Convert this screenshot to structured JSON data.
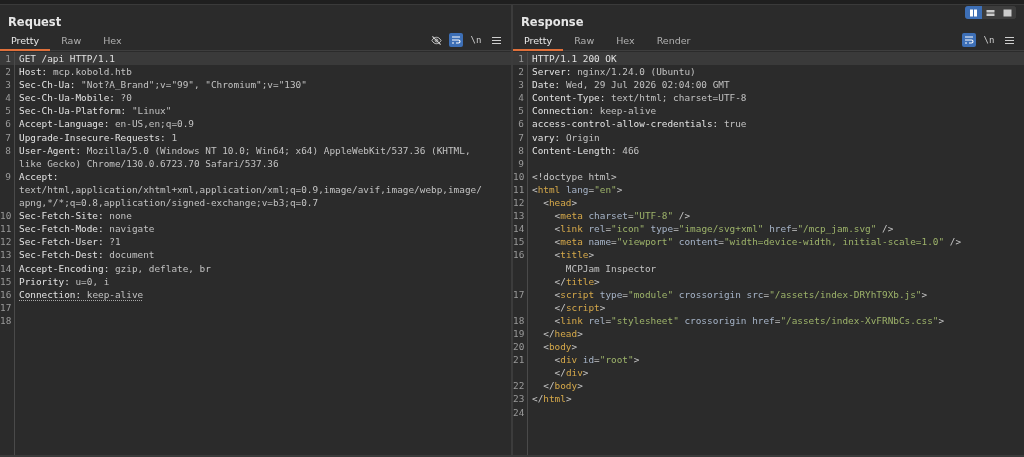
{
  "layout_toggle": [
    {
      "kind": "columns",
      "selected": true
    },
    {
      "kind": "rows",
      "selected": false
    },
    {
      "kind": "single",
      "selected": false
    }
  ],
  "panels": [
    {
      "title": "Request",
      "tabs": [
        {
          "label": "Pretty",
          "selected": true
        },
        {
          "label": "Raw",
          "selected": false
        },
        {
          "label": "Hex",
          "selected": false
        }
      ],
      "tools": [
        {
          "kind": "eye-off",
          "selected": false
        },
        {
          "kind": "wrap",
          "selected": true
        },
        {
          "kind": "newline",
          "label": "\\n",
          "selected": false
        },
        {
          "kind": "menu",
          "selected": false
        }
      ],
      "lines": [
        {
          "number": "1",
          "current": true,
          "tokens": [
            {
              "kind": "key",
              "text": "GET /api HTTP/1.1"
            }
          ]
        },
        {
          "number": "2",
          "tokens": [
            {
              "kind": "key",
              "text": "Host:"
            },
            {
              "kind": "value",
              "text": " mcp.kobold.htb"
            }
          ]
        },
        {
          "number": "3",
          "tokens": [
            {
              "kind": "key",
              "text": "Sec-Ch-Ua:"
            },
            {
              "kind": "value",
              "text": " \"Not?A_Brand\";v=\"99\", \"Chromium\";v=\"130\""
            }
          ]
        },
        {
          "number": "4",
          "tokens": [
            {
              "kind": "key",
              "text": "Sec-Ch-Ua-Mobile:"
            },
            {
              "kind": "value",
              "text": " ?0"
            }
          ]
        },
        {
          "number": "5",
          "tokens": [
            {
              "kind": "key",
              "text": "Sec-Ch-Ua-Platform:"
            },
            {
              "kind": "value",
              "text": " \"Linux\""
            }
          ]
        },
        {
          "number": "6",
          "tokens": [
            {
              "kind": "key",
              "text": "Accept-Language:"
            },
            {
              "kind": "value",
              "text": " en-US,en;q=0.9"
            }
          ]
        },
        {
          "number": "7",
          "tokens": [
            {
              "kind": "key",
              "text": "Upgrade-Insecure-Requests:"
            },
            {
              "kind": "value",
              "text": " 1"
            }
          ]
        },
        {
          "number": "8",
          "tokens": [
            {
              "kind": "key",
              "text": "User-Agent:"
            },
            {
              "kind": "value",
              "text": " Mozilla/5.0 (Windows NT 10.0; Win64; x64) AppleWebKit/537.36 (KHTML,"
            }
          ]
        },
        {
          "tokens": [
            {
              "kind": "value",
              "text": "like Gecko) Chrome/130.0.6723.70 Safari/537.36"
            }
          ]
        },
        {
          "number": "9",
          "tokens": [
            {
              "kind": "key",
              "text": "Accept:"
            }
          ]
        },
        {
          "tokens": [
            {
              "kind": "value",
              "text": "text/html,application/xhtml+xml,application/xml;q=0.9,image/avif,image/webp,image/"
            }
          ]
        },
        {
          "tokens": [
            {
              "kind": "value",
              "text": "apng,*/*;q=0.8,application/signed-exchange;v=b3;q=0.7"
            }
          ]
        },
        {
          "number": "10",
          "tokens": [
            {
              "kind": "key",
              "text": "Sec-Fetch-Site:"
            },
            {
              "kind": "value",
              "text": " none"
            }
          ]
        },
        {
          "number": "11",
          "tokens": [
            {
              "kind": "key",
              "text": "Sec-Fetch-Mode:"
            },
            {
              "kind": "value",
              "text": " navigate"
            }
          ]
        },
        {
          "number": "12",
          "tokens": [
            {
              "kind": "key",
              "text": "Sec-Fetch-User:"
            },
            {
              "kind": "value",
              "text": " ?1"
            }
          ]
        },
        {
          "number": "13",
          "tokens": [
            {
              "kind": "key",
              "text": "Sec-Fetch-Dest:"
            },
            {
              "kind": "value",
              "text": " document"
            }
          ]
        },
        {
          "number": "14",
          "tokens": [
            {
              "kind": "key",
              "text": "Accept-Encoding:"
            },
            {
              "kind": "value",
              "text": " gzip, deflate, br"
            }
          ]
        },
        {
          "number": "15",
          "tokens": [
            {
              "kind": "key",
              "text": "Priority:"
            },
            {
              "kind": "value",
              "text": " u=0, i"
            }
          ]
        },
        {
          "number": "16",
          "underlined": true,
          "tokens": [
            {
              "kind": "key",
              "text": "Connection:"
            },
            {
              "kind": "value",
              "text": " keep-alive"
            }
          ]
        },
        {
          "number": "17"
        },
        {
          "number": "18"
        }
      ]
    },
    {
      "title": "Response",
      "tabs": [
        {
          "label": "Pretty",
          "selected": true
        },
        {
          "label": "Raw",
          "selected": false
        },
        {
          "label": "Hex",
          "selected": false
        },
        {
          "label": "Render",
          "selected": false
        }
      ],
      "tools": [
        {
          "kind": "wrap",
          "selected": true
        },
        {
          "kind": "newline",
          "label": "\\n",
          "selected": false
        },
        {
          "kind": "menu",
          "selected": false
        }
      ],
      "lines": [
        {
          "number": "1",
          "current": true,
          "tokens": [
            {
              "kind": "key",
              "text": "HTTP/1.1 200 OK"
            }
          ]
        },
        {
          "number": "2",
          "tokens": [
            {
              "kind": "key",
              "text": "Server:"
            },
            {
              "kind": "value",
              "text": " nginx/1.24.0 (Ubuntu)"
            }
          ]
        },
        {
          "number": "3",
          "tokens": [
            {
              "kind": "key",
              "text": "Date:"
            },
            {
              "kind": "value",
              "text": " Wed, 29 Jul 2026 02:04:00 GMT"
            }
          ]
        },
        {
          "number": "4",
          "tokens": [
            {
              "kind": "key",
              "text": "Content-Type:"
            },
            {
              "kind": "value",
              "text": " text/html; charset=UTF-8"
            }
          ]
        },
        {
          "number": "5",
          "tokens": [
            {
              "kind": "key",
              "text": "Connection:"
            },
            {
              "kind": "value",
              "text": " keep-alive"
            }
          ]
        },
        {
          "number": "6",
          "tokens": [
            {
              "kind": "key",
              "text": "access-control-allow-credentials:"
            },
            {
              "kind": "value",
              "text": " true"
            }
          ]
        },
        {
          "number": "7",
          "tokens": [
            {
              "kind": "key",
              "text": "vary:"
            },
            {
              "kind": "value",
              "text": " Origin"
            }
          ]
        },
        {
          "number": "8",
          "tokens": [
            {
              "kind": "key",
              "text": "Content-Length:"
            },
            {
              "kind": "value",
              "text": " 466"
            }
          ]
        },
        {
          "number": "9"
        },
        {
          "number": "10",
          "tokens": [
            {
              "kind": "punct",
              "text": "<!doctype html>"
            }
          ]
        },
        {
          "number": "11",
          "tokens": [
            {
              "kind": "punct",
              "text": "<"
            },
            {
              "kind": "tag",
              "text": "html"
            },
            {
              "kind": "attr",
              "text": " lang"
            },
            {
              "kind": "punct",
              "text": "="
            },
            {
              "kind": "string",
              "text": "\"en\""
            },
            {
              "kind": "punct",
              "text": ">"
            }
          ]
        },
        {
          "number": "12",
          "tokens": [
            {
              "kind": "punct",
              "text": "  <"
            },
            {
              "kind": "tag",
              "text": "head"
            },
            {
              "kind": "punct",
              "text": ">"
            }
          ]
        },
        {
          "number": "13",
          "tokens": [
            {
              "kind": "punct",
              "text": "    <"
            },
            {
              "kind": "tag",
              "text": "meta"
            },
            {
              "kind": "attr",
              "text": " charset"
            },
            {
              "kind": "punct",
              "text": "="
            },
            {
              "kind": "string",
              "text": "\"UTF-8\""
            },
            {
              "kind": "punct",
              "text": " />"
            }
          ]
        },
        {
          "number": "14",
          "tokens": [
            {
              "kind": "punct",
              "text": "    <"
            },
            {
              "kind": "tag",
              "text": "link"
            },
            {
              "kind": "attr",
              "text": " rel"
            },
            {
              "kind": "punct",
              "text": "="
            },
            {
              "kind": "string",
              "text": "\"icon\""
            },
            {
              "kind": "attr",
              "text": " type"
            },
            {
              "kind": "punct",
              "text": "="
            },
            {
              "kind": "string",
              "text": "\"image/svg+xml\""
            },
            {
              "kind": "attr",
              "text": " href"
            },
            {
              "kind": "punct",
              "text": "="
            },
            {
              "kind": "string",
              "text": "\"/mcp_jam.svg\""
            },
            {
              "kind": "punct",
              "text": " />"
            }
          ]
        },
        {
          "number": "15",
          "tokens": [
            {
              "kind": "punct",
              "text": "    <"
            },
            {
              "kind": "tag",
              "text": "meta"
            },
            {
              "kind": "attr",
              "text": " name"
            },
            {
              "kind": "punct",
              "text": "="
            },
            {
              "kind": "string",
              "text": "\"viewport\""
            },
            {
              "kind": "attr",
              "text": " content"
            },
            {
              "kind": "punct",
              "text": "="
            },
            {
              "kind": "string",
              "text": "\"width=device-width, initial-scale=1.0\""
            },
            {
              "kind": "punct",
              "text": " />"
            }
          ]
        },
        {
          "number": "16",
          "tokens": [
            {
              "kind": "punct",
              "text": "    <"
            },
            {
              "kind": "tag",
              "text": "title"
            },
            {
              "kind": "punct",
              "text": ">"
            }
          ]
        },
        {
          "tokens": [
            {
              "kind": "value",
              "text": "      MCPJam Inspector"
            }
          ]
        },
        {
          "tokens": [
            {
              "kind": "punct",
              "text": "    </"
            },
            {
              "kind": "tag",
              "text": "title"
            },
            {
              "kind": "punct",
              "text": ">"
            }
          ]
        },
        {
          "number": "17",
          "tokens": [
            {
              "kind": "punct",
              "text": "    <"
            },
            {
              "kind": "tag",
              "text": "script"
            },
            {
              "kind": "attr",
              "text": " type"
            },
            {
              "kind": "punct",
              "text": "="
            },
            {
              "kind": "string",
              "text": "\"module\""
            },
            {
              "kind": "attr",
              "text": " crossorigin src"
            },
            {
              "kind": "punct",
              "text": "="
            },
            {
              "kind": "string",
              "text": "\"/assets/index-DRYhT9Xb.js\""
            },
            {
              "kind": "punct",
              "text": ">"
            }
          ]
        },
        {
          "tokens": [
            {
              "kind": "punct",
              "text": "    </"
            },
            {
              "kind": "tag",
              "text": "script"
            },
            {
              "kind": "punct",
              "text": ">"
            }
          ]
        },
        {
          "number": "18",
          "tokens": [
            {
              "kind": "punct",
              "text": "    <"
            },
            {
              "kind": "tag",
              "text": "link"
            },
            {
              "kind": "attr",
              "text": " rel"
            },
            {
              "kind": "punct",
              "text": "="
            },
            {
              "kind": "string",
              "text": "\"stylesheet\""
            },
            {
              "kind": "attr",
              "text": " crossorigin href"
            },
            {
              "kind": "punct",
              "text": "="
            },
            {
              "kind": "string",
              "text": "\"/assets/index-XvFRNbCs.css\""
            },
            {
              "kind": "punct",
              "text": ">"
            }
          ]
        },
        {
          "number": "19",
          "tokens": [
            {
              "kind": "punct",
              "text": "  </"
            },
            {
              "kind": "tag",
              "text": "head"
            },
            {
              "kind": "punct",
              "text": ">"
            }
          ]
        },
        {
          "number": "20",
          "tokens": [
            {
              "kind": "punct",
              "text": "  <"
            },
            {
              "kind": "tag",
              "text": "body"
            },
            {
              "kind": "punct",
              "text": ">"
            }
          ]
        },
        {
          "number": "21",
          "tokens": [
            {
              "kind": "punct",
              "text": "    <"
            },
            {
              "kind": "tag",
              "text": "div"
            },
            {
              "kind": "attr",
              "text": " id"
            },
            {
              "kind": "punct",
              "text": "="
            },
            {
              "kind": "string",
              "text": "\"root\""
            },
            {
              "kind": "punct",
              "text": ">"
            }
          ]
        },
        {
          "tokens": [
            {
              "kind": "punct",
              "text": "    </"
            },
            {
              "kind": "tag",
              "text": "div"
            },
            {
              "kind": "punct",
              "text": ">"
            }
          ]
        },
        {
          "number": "22",
          "tokens": [
            {
              "kind": "punct",
              "text": "  </"
            },
            {
              "kind": "tag",
              "text": "body"
            },
            {
              "kind": "punct",
              "text": ">"
            }
          ]
        },
        {
          "number": "23",
          "tokens": [
            {
              "kind": "punct",
              "text": "</"
            },
            {
              "kind": "tag",
              "text": "html"
            },
            {
              "kind": "punct",
              "text": ">"
            }
          ]
        },
        {
          "number": "24"
        }
      ]
    }
  ]
}
